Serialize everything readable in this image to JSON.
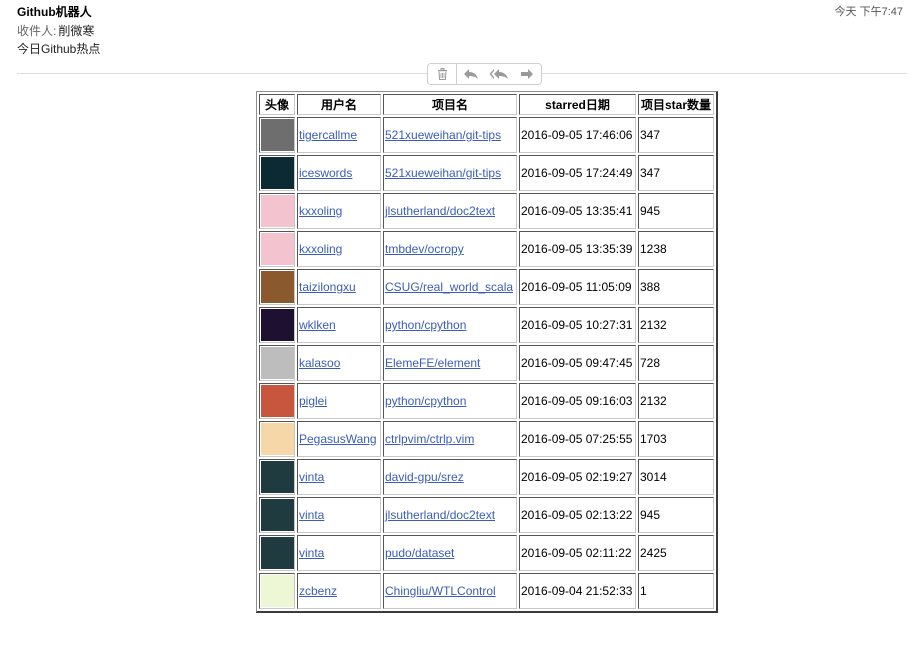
{
  "email": {
    "sender": "Github机器人",
    "time": "今天 下午7:47",
    "recipient_label": "收件人:",
    "recipient_name": "削微寒",
    "subject": "今日Github热点"
  },
  "toolbar": {
    "icons": [
      "trash-icon",
      "reply-icon",
      "reply-all-icon",
      "forward-icon"
    ]
  },
  "table": {
    "headers": {
      "avatar": "头像",
      "user": "用户名",
      "repo": "项目名",
      "starred": "starred日期",
      "stars": "项目star数量"
    },
    "rows": [
      {
        "user": "tigercallme",
        "repo": "521xueweihan/git-tips",
        "date": "2016-09-05 17:46:06",
        "stars": "347",
        "avatar_color": "#6e6e6e"
      },
      {
        "user": "iceswords",
        "repo": "521xueweihan/git-tips",
        "date": "2016-09-05 17:24:49",
        "stars": "347",
        "avatar_color": "#0b2a33"
      },
      {
        "user": "kxxoling",
        "repo": "jlsutherland/doc2text",
        "date": "2016-09-05 13:35:41",
        "stars": "945",
        "avatar_color": "#f3c3cf"
      },
      {
        "user": "kxxoling",
        "repo": "tmbdev/ocropy",
        "date": "2016-09-05 13:35:39",
        "stars": "1238",
        "avatar_color": "#f3c3cf"
      },
      {
        "user": "taizilongxu",
        "repo": "CSUG/real_world_scala",
        "date": "2016-09-05 11:05:09",
        "stars": "388",
        "avatar_color": "#8a5a2e"
      },
      {
        "user": "wklken",
        "repo": "python/cpython",
        "date": "2016-09-05 10:27:31",
        "stars": "2132",
        "avatar_color": "#1d1030"
      },
      {
        "user": "kalasoo",
        "repo": "ElemeFE/element",
        "date": "2016-09-05 09:47:45",
        "stars": "728",
        "avatar_color": "#bdbdbd"
      },
      {
        "user": "piglei",
        "repo": "python/cpython",
        "date": "2016-09-05 09:16:03",
        "stars": "2132",
        "avatar_color": "#c8563f"
      },
      {
        "user": "PegasusWang",
        "repo": "ctrlpvim/ctrlp.vim",
        "date": "2016-09-05 07:25:55",
        "stars": "1703",
        "avatar_color": "#f5d7a8"
      },
      {
        "user": "vinta",
        "repo": "david-gpu/srez",
        "date": "2016-09-05 02:19:27",
        "stars": "3014",
        "avatar_color": "#1f3b3f"
      },
      {
        "user": "vinta",
        "repo": "jlsutherland/doc2text",
        "date": "2016-09-05 02:13:22",
        "stars": "945",
        "avatar_color": "#1f3b3f"
      },
      {
        "user": "vinta",
        "repo": "pudo/dataset",
        "date": "2016-09-05 02:11:22",
        "stars": "2425",
        "avatar_color": "#1f3b3f"
      },
      {
        "user": "zcbenz",
        "repo": "Chingliu/WTLControl",
        "date": "2016-09-04 21:52:33",
        "stars": "1",
        "avatar_color": "#eef7d5"
      }
    ]
  }
}
